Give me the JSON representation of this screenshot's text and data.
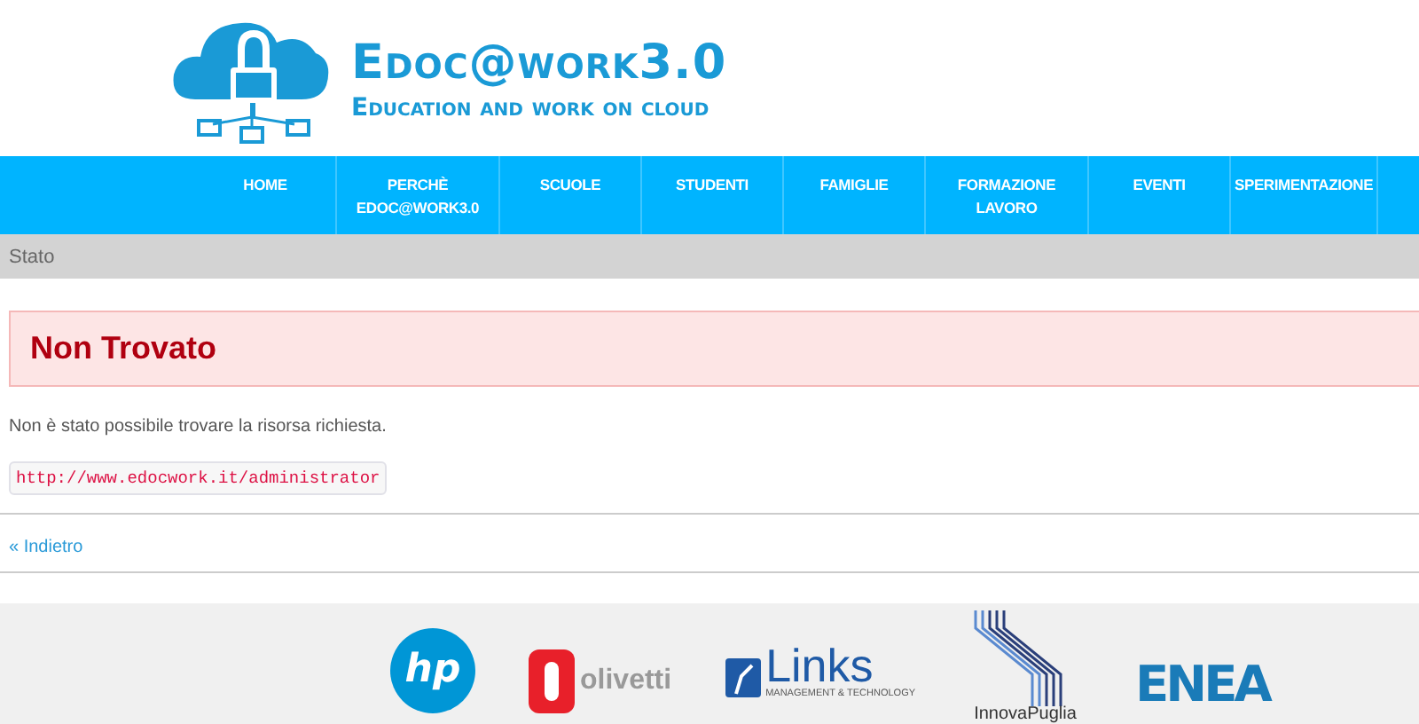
{
  "header": {
    "brand": "Edoc@work3.0",
    "tagline": "Education and work on cloud"
  },
  "nav": [
    {
      "label": "HOME"
    },
    {
      "label": "PERCHÈ EDOC@WORK3.0"
    },
    {
      "label": "SCUOLE"
    },
    {
      "label": "STUDENTI"
    },
    {
      "label": "FAMIGLIE"
    },
    {
      "label": "FORMAZIONE LAVORO"
    },
    {
      "label": "EVENTI"
    },
    {
      "label": "SPERIMENTAZIONE"
    }
  ],
  "breadcrumb": "Stato",
  "error": {
    "title": "Non Trovato",
    "message": "Non è stato possibile trovare la risorsa richiesta.",
    "url": "http://www.edocwork.it/administrator"
  },
  "back_link": "« Indietro",
  "partners": [
    {
      "kind": "hp",
      "text": "hp"
    },
    {
      "kind": "olivetti",
      "text": "olivetti"
    },
    {
      "kind": "links",
      "text": "Links",
      "subtext": "MANAGEMENT & TECHNOLOGY"
    },
    {
      "kind": "innova",
      "text": "InnovaPuglia"
    },
    {
      "kind": "enea",
      "text": "ENEA"
    }
  ]
}
